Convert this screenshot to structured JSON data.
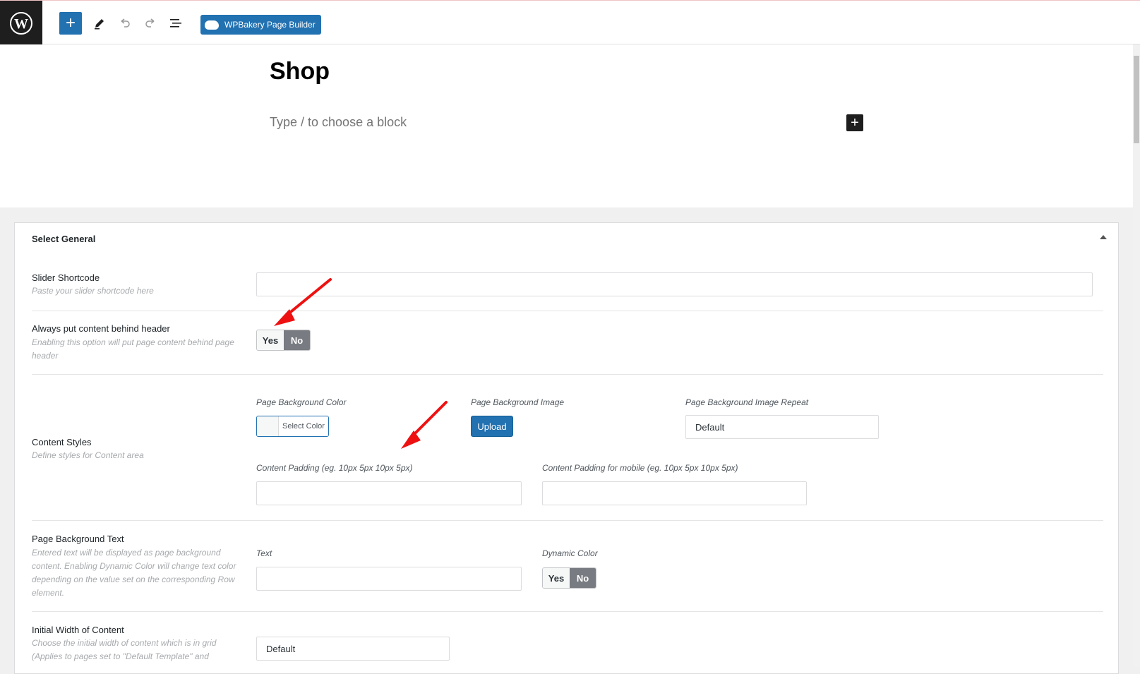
{
  "toolbar": {
    "add_icon": "plus-icon",
    "add_symbol": "+",
    "wpbakery_label": "WPBakery Page Builder"
  },
  "editor": {
    "title": "Shop",
    "placeholder": "Type / to choose a block",
    "inserter_symbol": "+"
  },
  "panel": {
    "heading": "Select General",
    "slider": {
      "label": "Slider Shortcode",
      "desc": "Paste your slider shortcode here",
      "value": ""
    },
    "behind_header": {
      "label": "Always put content behind header",
      "desc": "Enabling this option will put page content behind page header",
      "yes": "Yes",
      "no": "No",
      "selected": "No"
    },
    "content_styles": {
      "label": "Content Styles",
      "desc": "Define styles for Content area",
      "bg_color_label": "Page Background Color",
      "select_color": "Select Color",
      "bg_image_label": "Page Background Image",
      "upload": "Upload",
      "bg_repeat_label": "Page Background Image Repeat",
      "bg_repeat_value": "Default",
      "padding_label": "Content Padding (eg. 10px 5px 10px 5px)",
      "padding_mobile_label": "Content Padding for mobile (eg. 10px 5px 10px 5px)"
    },
    "bg_text": {
      "label": "Page Background Text",
      "desc": "Entered text will be displayed as page background content. Enabling Dynamic Color will change text color depending on the value set on the corresponding Row element.",
      "text_label": "Text",
      "dynamic_label": "Dynamic Color",
      "yes": "Yes",
      "no": "No",
      "selected": "No"
    },
    "initial_width": {
      "label": "Initial Width of Content",
      "desc": "Choose the initial width of content which is in grid (Applies to pages set to \"Default Template\" and",
      "value": "Default"
    }
  },
  "colors": {
    "accent": "#2271b1",
    "arrow": "#ee1111"
  }
}
